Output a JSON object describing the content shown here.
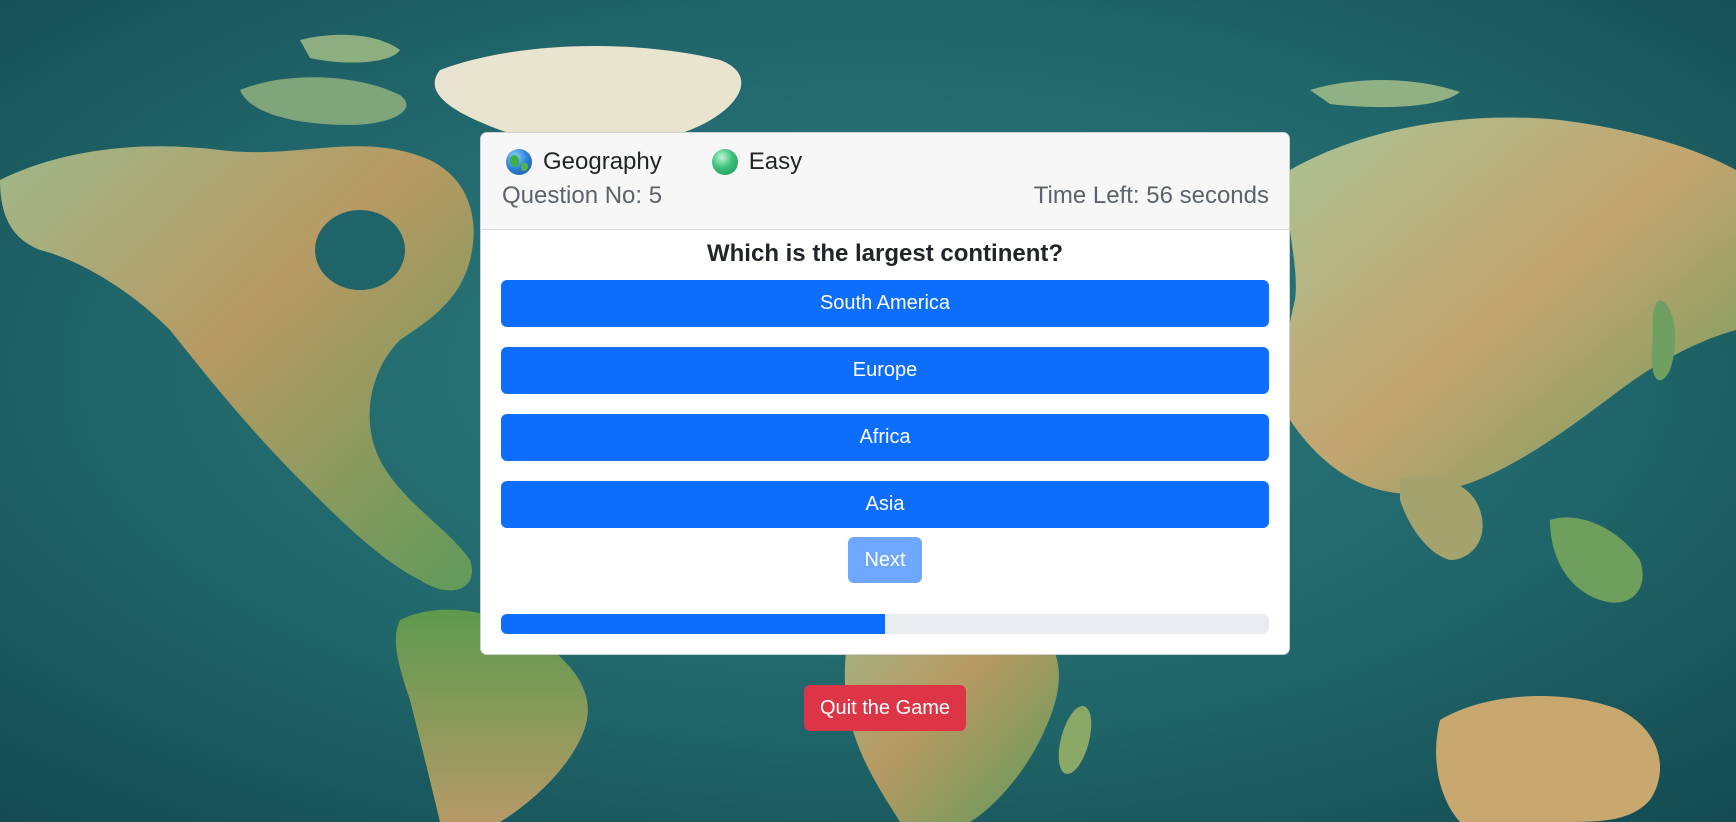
{
  "header": {
    "category": {
      "label": "Geography",
      "icon": "globe-icon"
    },
    "difficulty": {
      "label": "Easy",
      "icon": "green-circle-icon"
    },
    "question_number": "Question No: 5",
    "time_left": "Time Left: 56 seconds"
  },
  "question": {
    "text": "Which is the largest continent?"
  },
  "answers": [
    {
      "label": "South America"
    },
    {
      "label": "Europe"
    },
    {
      "label": "Africa"
    },
    {
      "label": "Asia"
    }
  ],
  "next_button": {
    "label": "Next",
    "disabled": true
  },
  "progress": {
    "percent": 50
  },
  "quit_button": {
    "label": "Quit the Game"
  },
  "colors": {
    "primary": "#0d6efd",
    "primary_disabled": "#6ea8fe",
    "danger": "#dc3545",
    "progress_track": "#e9ecef"
  }
}
